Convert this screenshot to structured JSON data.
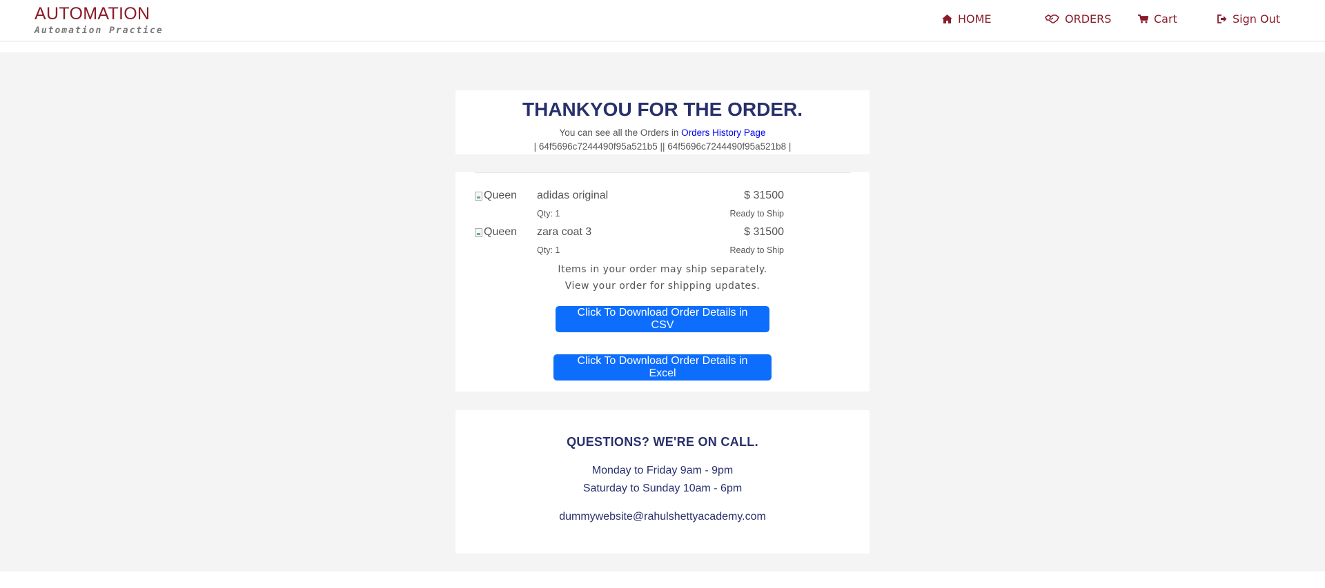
{
  "brand": {
    "title": "AUTOMATION",
    "subtitle": "Automation Practice"
  },
  "nav": {
    "home": {
      "label": "HOME",
      "icon": "home-icon"
    },
    "orders": {
      "label": "ORDERS",
      "icon": "handshake-icon"
    },
    "cart": {
      "label": "Cart",
      "icon": "cart-icon"
    },
    "signout": {
      "label": "Sign Out",
      "icon": "sign-out-icon"
    }
  },
  "thanks": {
    "title": "THANKYOU FOR THE ORDER.",
    "history_prefix": "You can see all the Orders in ",
    "history_link": "Orders History Page",
    "order_ids": "| 64f5696c7244490f95a521b5 || 64f5696c7244490f95a521b8 |"
  },
  "items": [
    {
      "img_alt": "Queen",
      "name": "adidas original",
      "price": "$ 31500",
      "qty": "Qty: 1",
      "status": "Ready to Ship"
    },
    {
      "img_alt": "Queen",
      "name": "zara coat 3",
      "price": "$ 31500",
      "qty": "Qty: 1",
      "status": "Ready to Ship"
    }
  ],
  "shipping": {
    "line1": "Items in your order may ship separately.",
    "line2": "View your order for shipping updates."
  },
  "buttons": {
    "csv": "Click To Download Order Details in CSV",
    "excel": "Click To Download Order Details in Excel"
  },
  "contact": {
    "title": "QUESTIONS? WE'RE ON CALL.",
    "weekdays": "Monday to Friday 9am - 9pm",
    "weekend": "Saturday to Sunday 10am - 6pm",
    "email": "dummywebsite@rahulshettyacademy.com"
  },
  "colors": {
    "brand": "#8b1b2a",
    "navy": "#28306c",
    "primary": "#0d6efd",
    "link": "#0000ee",
    "background": "#f4f4f4"
  }
}
